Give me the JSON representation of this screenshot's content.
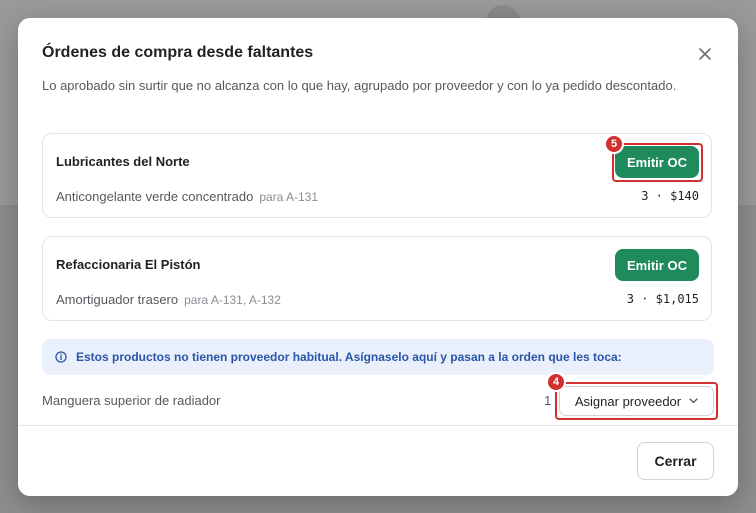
{
  "modal": {
    "title": "Órdenes de compra desde faltantes",
    "description": "Lo aprobado sin surtir que no alcanza con lo que hay, agrupado por proveedor y con lo ya pedido descontado."
  },
  "orders": [
    {
      "supplier": "Lubricantes del Norte",
      "button_label": "Emitir OC",
      "marker": "5",
      "product": "Anticongelante verde concentrado",
      "for": "para A-131",
      "amount": "3 · $140"
    },
    {
      "supplier": "Refaccionaria El Pistón",
      "button_label": "Emitir OC",
      "product": "Amortiguador trasero",
      "for": "para A-131, A-132",
      "amount": "3 · $1,015"
    }
  ],
  "unassigned": {
    "info": "Estos productos no tienen proveedor habitual. Asígnaselo aquí y pasan a la orden que les toca:",
    "item": "Manguera superior de radiador",
    "qty": "1",
    "button_label": "Asignar proveedor",
    "marker": "4"
  },
  "footer": {
    "close_label": "Cerrar"
  },
  "icons": {
    "close": "close-icon",
    "info": "info-circle-icon",
    "chevron": "chevron-down-icon"
  },
  "colors": {
    "primary": "#1f8a5b",
    "highlight": "#d22f2f",
    "info_bg": "#eaf0fb",
    "info_text": "#2a55a8"
  }
}
